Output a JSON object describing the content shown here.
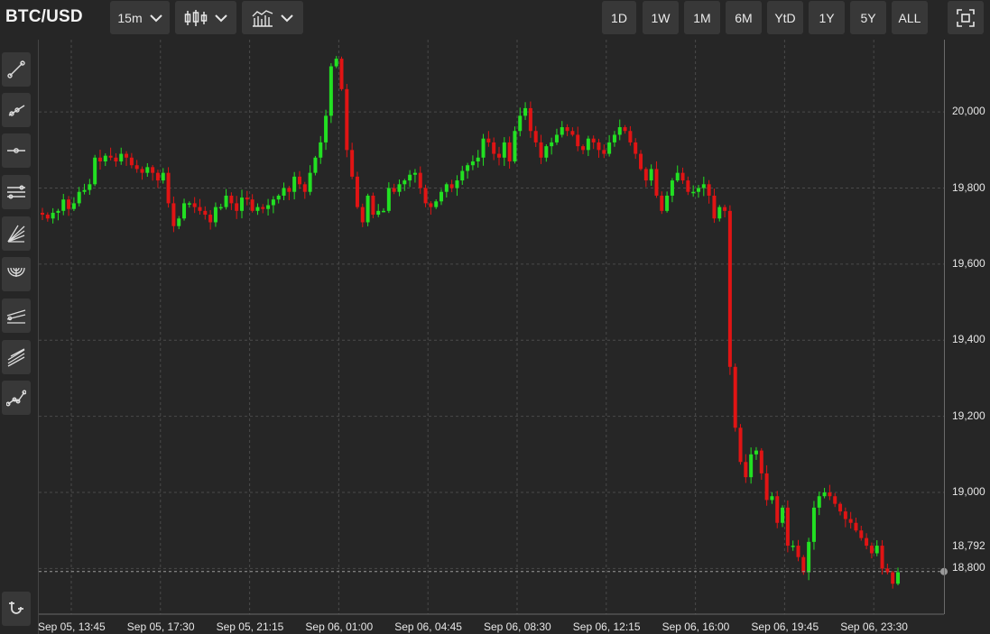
{
  "header": {
    "symbol": "BTC/USD",
    "interval": "15m",
    "ranges": [
      "1D",
      "1W",
      "1M",
      "6M",
      "YtD",
      "1Y",
      "5Y",
      "ALL"
    ]
  },
  "tools": [
    "trend-line-icon",
    "ray-icon",
    "horizontal-line-icon",
    "parallel-channel-icon",
    "fan-icon",
    "arc-icon",
    "regression-icon",
    "pitchfork-icon",
    "path-icon",
    "magnet-icon"
  ],
  "chart_data": {
    "type": "candlestick",
    "title": "BTC/USD",
    "y_ticks": [
      "20,000",
      "19,800",
      "19,600",
      "19,400",
      "19,200",
      "19,000",
      "18,800"
    ],
    "x_ticks": [
      "Sep 05, 13:45",
      "Sep 05, 17:30",
      "Sep 05, 21:15",
      "Sep 06, 01:00",
      "Sep 06, 04:45",
      "Sep 06, 08:30",
      "Sep 06, 12:15",
      "Sep 06, 16:00",
      "Sep 06, 19:45",
      "Sep 06, 23:30"
    ],
    "ylim": [
      18680,
      20190
    ],
    "last_price": "18,792",
    "last_price_value": 18792,
    "colors": {
      "up": "#22e022",
      "down": "#e01414",
      "grid": "#4a4a4a"
    },
    "closes": [
      19730,
      19720,
      19735,
      19740,
      19770,
      19745,
      19760,
      19790,
      19795,
      19810,
      19880,
      19870,
      19885,
      19880,
      19870,
      19890,
      19880,
      19860,
      19850,
      19840,
      19855,
      19840,
      19820,
      19840,
      19760,
      19700,
      19720,
      19760,
      19760,
      19750,
      19740,
      19730,
      19710,
      19750,
      19750,
      19780,
      19760,
      19740,
      19775,
      19770,
      19740,
      19750,
      19745,
      19755,
      19770,
      19780,
      19800,
      19790,
      19830,
      19810,
      19790,
      19840,
      19880,
      19920,
      19990,
      20120,
      20140,
      20060,
      19900,
      19830,
      19750,
      19710,
      19780,
      19730,
      19740,
      19740,
      19800,
      19790,
      19810,
      19820,
      19835,
      19840,
      19800,
      19760,
      19750,
      19765,
      19790,
      19810,
      19800,
      19820,
      19845,
      19860,
      19870,
      19880,
      19930,
      19920,
      19890,
      19880,
      19920,
      19870,
      19950,
      19990,
      20010,
      19950,
      19920,
      19880,
      19910,
      19920,
      19940,
      19960,
      19950,
      19940,
      19910,
      19900,
      19930,
      19920,
      19900,
      19890,
      19920,
      19940,
      19960,
      19950,
      19920,
      19890,
      19850,
      19820,
      19850,
      19780,
      19740,
      19780,
      19820,
      19840,
      19820,
      19790,
      19790,
      19800,
      19810,
      19780,
      19720,
      19750,
      19740,
      19330,
      19170,
      19080,
      19040,
      19100,
      19110,
      19050,
      18980,
      18990,
      18920,
      18960,
      18860,
      18860,
      18830,
      18790,
      18870,
      18960,
      18990,
      19000,
      18990,
      18970,
      18950,
      18930,
      18920,
      18900,
      18880,
      18860,
      18840,
      18860,
      18800,
      18790,
      18760,
      18790
    ]
  }
}
